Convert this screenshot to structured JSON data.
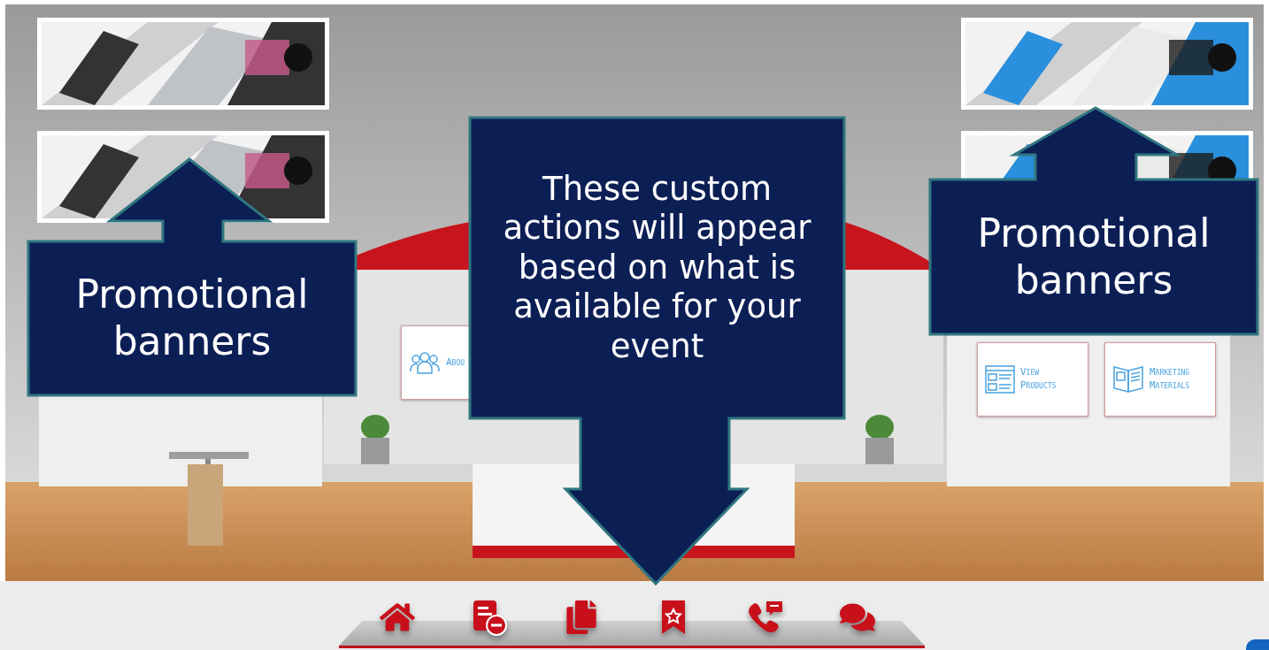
{
  "booth_panels": [
    {
      "label": "Abou",
      "kind": "about"
    },
    {
      "label": "View\nProducts",
      "kind": "products"
    },
    {
      "label": "Marketing\nMaterials",
      "kind": "materials"
    }
  ],
  "callouts": [
    {
      "text": "Promotional banners",
      "kind": "up"
    },
    {
      "text": "These custom actions will appear based on what is available for your event",
      "kind": "down"
    },
    {
      "text": "Promotional banners",
      "kind": "up"
    }
  ],
  "toolbar": [
    {
      "kind": "home"
    },
    {
      "kind": "document-remove"
    },
    {
      "kind": "documents"
    },
    {
      "kind": "bookmark"
    },
    {
      "kind": "phone-message"
    },
    {
      "kind": "chat"
    }
  ]
}
